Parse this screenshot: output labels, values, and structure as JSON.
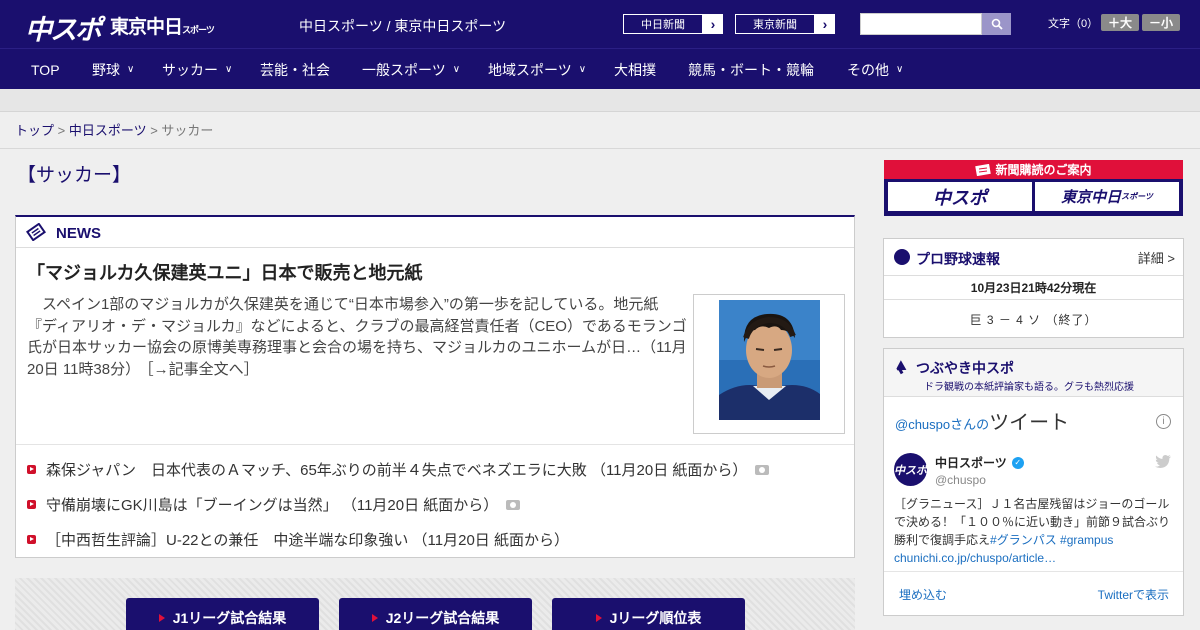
{
  "header": {
    "logo_chuspo": "中スポ",
    "logo_tokyo": "東京中日",
    "logo_tokyo_small": "スポーツ",
    "site_names": "中日スポーツ / 東京中日スポーツ",
    "paper_links": [
      {
        "label": "中日新聞"
      },
      {
        "label": "東京新聞"
      }
    ],
    "search_placeholder": "",
    "font_size_label": "文字（0）",
    "font_bigger": "＋大",
    "font_smaller": "－小"
  },
  "nav": {
    "items": [
      {
        "label": "TOP",
        "has_menu": false
      },
      {
        "label": "野球",
        "has_menu": true
      },
      {
        "label": "サッカー",
        "has_menu": true
      },
      {
        "label": "芸能・社会",
        "has_menu": false
      },
      {
        "label": "一般スポーツ",
        "has_menu": true
      },
      {
        "label": "地域スポーツ",
        "has_menu": true
      },
      {
        "label": "大相撲",
        "has_menu": false
      },
      {
        "label": "競馬・ボート・競輪",
        "has_menu": false
      },
      {
        "label": "その他",
        "has_menu": true
      }
    ]
  },
  "breadcrumb": {
    "top": "トップ",
    "sep": " > ",
    "chunichi": "中日スポーツ",
    "current": "サッカー"
  },
  "section_title": "【サッカー】",
  "news": {
    "label": "NEWS",
    "headline": "「マジョルカ久保建英ユニ」日本で販売と地元紙",
    "lead": "　スペイン1部のマジョルカが久保建英を通じて“日本市場参入”の第一歩を記している。地元紙『ディアリオ・デ・マジョルカ』などによると、クラブの最高経営責任者（CEO）であるモランゴ氏が日本サッカー協会の原博美専務理事と会合の場を持ち、マジョルカのユニホームが日…（11月20日 11時38分）",
    "more": "［→記事全文へ］",
    "list": [
      {
        "text": "森保ジャパン　日本代表のＡマッチ、65年ぶりの前半４失点でベネズエラに大敗 （11月20日 紙面から）",
        "has_photo": true
      },
      {
        "text": "守備崩壊にGK川島は「ブーイングは当然」 （11月20日 紙面から）",
        "has_photo": true
      },
      {
        "text": "［中西哲生評論］U-22との兼任　中途半端な印象強い （11月20日 紙面から）",
        "has_photo": false
      }
    ]
  },
  "jleague": {
    "buttons": [
      {
        "label": "J1リーグ試合結果"
      },
      {
        "label": "J2リーグ試合結果"
      },
      {
        "label": "Jリーグ順位表"
      }
    ]
  },
  "subscribe": {
    "header": "新聞購読のご案内",
    "left": "中スポ",
    "right": "東京中日",
    "right_small": "スポーツ"
  },
  "baseball": {
    "title": "プロ野球速報",
    "detail": "詳細 >",
    "time": "10月23日21時42分現在",
    "score": "巨 3 － 4 ソ （終了）"
  },
  "tweets": {
    "title": "つぶやき中スポ",
    "subtitle": "ドラ観戦の本紙評論家も語る。グラも熱烈応援",
    "heading_handle": "@chuspoさんの",
    "heading_word": "ツイート",
    "info": "i",
    "avatar_text": "中スポ",
    "account_name": "中日スポーツ",
    "account_handle": "@chuspo",
    "tweet_text": "［グラニュース］Ｊ１名古屋残留はジョーのゴールで決める！「１００％に近い動き」前節９試合ぶり勝利で復調手応え",
    "tweet_tags": "#グランパス #grampus",
    "tweet_link": "chunichi.co.jp/chuspo/article…",
    "embed": "埋め込む",
    "view_on_twitter": "Twitterで表示"
  },
  "colors": {
    "brand_navy": "#1a0f6e",
    "accent_red": "#e0103a",
    "link_blue": "#1a6ec0"
  }
}
